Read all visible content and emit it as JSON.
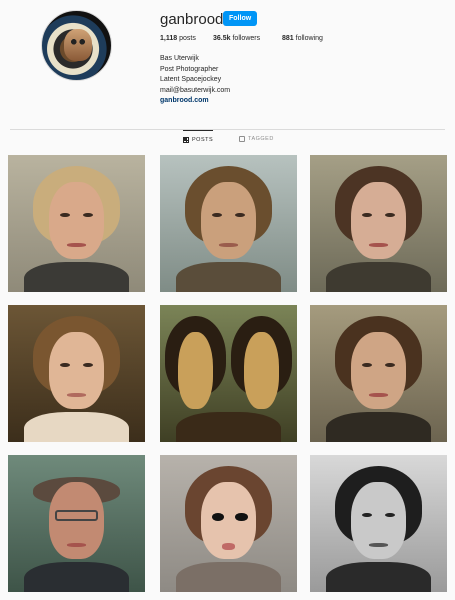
{
  "profile": {
    "username": "ganbrood",
    "follow_label": "Follow",
    "stats": {
      "posts_count": "1,118",
      "posts_label": "posts",
      "followers_count": "36.5k",
      "followers_label": "followers",
      "following_count": "881",
      "following_label": "following"
    },
    "bio": {
      "name": "Bas Uterwijk",
      "line1": "Post Photographer",
      "line2": "Latent Spacejockey",
      "email": "mail@basuterwijk.com",
      "website": "ganbrood.com"
    }
  },
  "tabs": [
    {
      "label": "POSTS",
      "icon": "grid-icon",
      "active": true
    },
    {
      "label": "TAGGED",
      "icon": "tag-icon",
      "active": false
    }
  ],
  "colors": {
    "accent": "#0095f6",
    "link": "#00376b",
    "background": "#fafafa"
  },
  "posts": [
    {
      "subject": "older woman with blonde hair"
    },
    {
      "subject": "man with curly hair"
    },
    {
      "subject": "woman with dark hair"
    },
    {
      "subject": "woman with hair pulled back"
    },
    {
      "subject": "two Mona Lisa style portraits"
    },
    {
      "subject": "young man with short hair"
    },
    {
      "subject": "balding man with glasses"
    },
    {
      "subject": "doll-like girl"
    },
    {
      "subject": "woman in black and white"
    }
  ]
}
